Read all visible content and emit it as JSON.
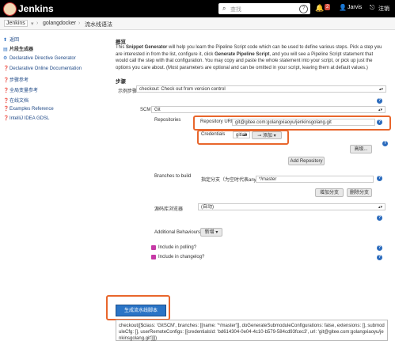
{
  "topbar": {
    "brand": "Jenkins",
    "search_placeholder": "查找",
    "notifications": "2",
    "user": "Jarvis",
    "logout": "注销"
  },
  "breadcrumb": [
    "Jenkins",
    "golangdocker",
    "流水线语法"
  ],
  "sidebar": {
    "items": [
      {
        "label": "返回",
        "icon": "up-arrow-icon"
      },
      {
        "label": "片段生成器",
        "icon": "snippet-icon"
      },
      {
        "label": "Declarative Directive Generator",
        "icon": "gear-icon"
      },
      {
        "label": "Declarative Online Documentation",
        "icon": "help-icon"
      },
      {
        "label": "步骤参考",
        "icon": "help-icon"
      },
      {
        "label": "全局变量参考",
        "icon": "help-icon"
      },
      {
        "label": "在线文档",
        "icon": "help-icon"
      },
      {
        "label": "Examples Reference",
        "icon": "help-icon"
      },
      {
        "label": "IntelliJ IDEA GDSL",
        "icon": "help-icon"
      }
    ]
  },
  "overview": {
    "heading": "概览",
    "text_a": "This ",
    "bold_a": "Snippet Generator",
    "text_b": " will help you learn the Pipeline Script code which can be used to define various steps. Pick a step you are interested in from the list, configure it, click ",
    "bold_b": "Generate Pipeline Script",
    "text_c": ", and you will see a Pipeline Script statement that would call the step with that configuration. You may copy and paste the whole statement into your script, or pick up just the options you care about. (Most parameters are optional and can be omitted in your script, leaving them at default values.)"
  },
  "steps": {
    "heading": "步骤",
    "sample_label": "示例步骤",
    "sample_value": "checkout: Check out from version control"
  },
  "scm": {
    "label": "SCM",
    "value": "Git",
    "repositories_label": "Repositories",
    "repo_url_label": "Repository URL",
    "repo_url_value": "git@gitee.com:golangxiaoyu/jenkinsgolang.git",
    "credentials_label": "Credentials",
    "credentials_value": "gitlab",
    "add_credentials": "添加",
    "advanced": "高级...",
    "add_repository": "Add Repository"
  },
  "branches": {
    "label": "Branches to build",
    "specifier_label": "指定分支（为空时代表any）",
    "specifier_value": "*/master",
    "add_branch": "增加分支",
    "delete_branch": "删除分支"
  },
  "browser": {
    "label": "源码库浏览器",
    "value": "(自动)"
  },
  "behaviours": {
    "label": "Additional Behaviours",
    "add": "新增"
  },
  "options": {
    "polling": "Include in polling?",
    "changelog": "Include in changelog?"
  },
  "generate_button": "生成流水线脚本",
  "output": "checkout([$class: 'GitSCM', branches: [[name: '*/master']], doGenerateSubmoduleConfigurations: false, extensions: [], submoduleCfg: [], userRemoteConfigs: [[credentialsId: 'bd614304-0e04-4c10-b579-584cd93fcec3', url: 'git@gitee.com:golangxiaoyu/jenkinsgolang.git']]])",
  "colors": {
    "topbar": "#000000",
    "highlight": "#e8662c",
    "primary": "#2a74c6",
    "badge": "#d24939"
  }
}
